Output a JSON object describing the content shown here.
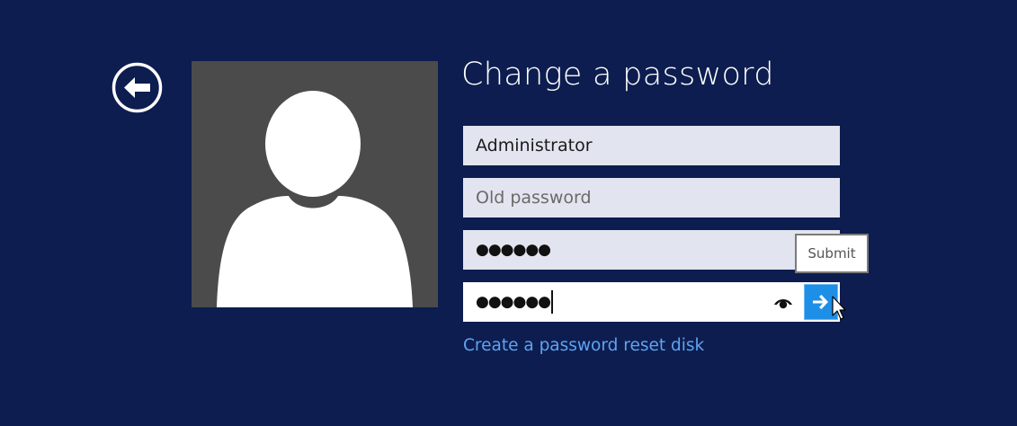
{
  "screen": {
    "title": "Change a password",
    "background_color": "#0d1d4f"
  },
  "back_button": {
    "icon": "back-arrow-icon"
  },
  "avatar": {
    "icon": "user-silhouette-icon"
  },
  "fields": {
    "username": {
      "value": "Administrator"
    },
    "old_password": {
      "placeholder": "Old password",
      "value": ""
    },
    "new_password": {
      "value": "●●●●●●"
    },
    "confirm_password": {
      "value": "●●●●●●"
    }
  },
  "reveal_icon": "eye-icon",
  "submit": {
    "tooltip": "Submit",
    "icon": "right-arrow-icon",
    "color": "#1e8fe6"
  },
  "links": {
    "reset_disk": "Create a password reset disk",
    "link_color": "#5ea3f2"
  }
}
